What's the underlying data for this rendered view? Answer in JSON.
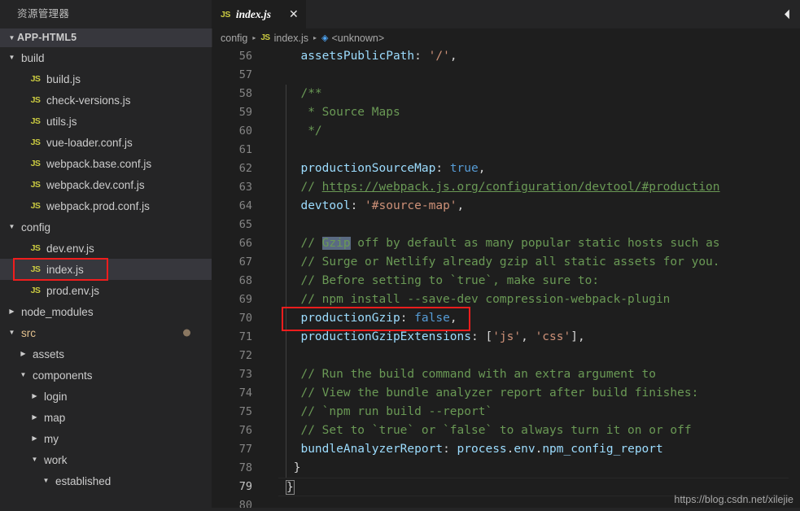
{
  "sidebar": {
    "title": "资源管理器",
    "root_label": "APP-HTML5",
    "items": [
      {
        "label": "build",
        "type": "folder",
        "indent": 1,
        "twist": "open",
        "icon": "folder-icon"
      },
      {
        "label": "build.js",
        "type": "file",
        "indent": 2,
        "twist": "none",
        "icon": "js-file-icon"
      },
      {
        "label": "check-versions.js",
        "type": "file",
        "indent": 2,
        "twist": "none",
        "icon": "js-file-icon"
      },
      {
        "label": "utils.js",
        "type": "file",
        "indent": 2,
        "twist": "none",
        "icon": "js-file-icon"
      },
      {
        "label": "vue-loader.conf.js",
        "type": "file",
        "indent": 2,
        "twist": "none",
        "icon": "js-file-icon"
      },
      {
        "label": "webpack.base.conf.js",
        "type": "file",
        "indent": 2,
        "twist": "none",
        "icon": "js-file-icon"
      },
      {
        "label": "webpack.dev.conf.js",
        "type": "file",
        "indent": 2,
        "twist": "none",
        "icon": "js-file-icon"
      },
      {
        "label": "webpack.prod.conf.js",
        "type": "file",
        "indent": 2,
        "twist": "none",
        "icon": "js-file-icon"
      },
      {
        "label": "config",
        "type": "folder",
        "indent": 1,
        "twist": "open",
        "icon": "folder-icon"
      },
      {
        "label": "dev.env.js",
        "type": "file",
        "indent": 2,
        "twist": "none",
        "icon": "js-file-icon"
      },
      {
        "label": "index.js",
        "type": "file",
        "indent": 2,
        "twist": "none",
        "icon": "js-file-icon",
        "selected": true,
        "highlighted": true
      },
      {
        "label": "prod.env.js",
        "type": "file",
        "indent": 2,
        "twist": "none",
        "icon": "js-file-icon"
      },
      {
        "label": "node_modules",
        "type": "folder",
        "indent": 1,
        "twist": "closed",
        "icon": "folder-icon"
      },
      {
        "label": "src",
        "type": "folder",
        "indent": 1,
        "twist": "open",
        "icon": "folder-icon",
        "accent": true,
        "dirty": true
      },
      {
        "label": "assets",
        "type": "folder",
        "indent": 2,
        "twist": "closed",
        "icon": "folder-icon"
      },
      {
        "label": "components",
        "type": "folder",
        "indent": 2,
        "twist": "open",
        "icon": "folder-icon"
      },
      {
        "label": "login",
        "type": "folder",
        "indent": 3,
        "twist": "closed",
        "icon": "folder-icon"
      },
      {
        "label": "map",
        "type": "folder",
        "indent": 3,
        "twist": "closed",
        "icon": "folder-icon"
      },
      {
        "label": "my",
        "type": "folder",
        "indent": 3,
        "twist": "closed",
        "icon": "folder-icon"
      },
      {
        "label": "work",
        "type": "folder",
        "indent": 3,
        "twist": "open",
        "icon": "folder-icon"
      },
      {
        "label": "established",
        "type": "folder",
        "indent": 4,
        "twist": "open",
        "icon": "folder-icon"
      }
    ]
  },
  "tabs": [
    {
      "label": "index.js",
      "icon": "js-file-icon",
      "close_icon": "close-icon",
      "active": true
    }
  ],
  "tab_actions": {
    "split_icon": "split-editor-icon"
  },
  "breadcrumb": {
    "segments": [
      {
        "label": "config",
        "icon": null
      },
      {
        "label": "index.js",
        "icon": "js-file-icon"
      },
      {
        "label": "<unknown>",
        "icon": "symbol-object-icon"
      }
    ],
    "separator": "▸"
  },
  "editor": {
    "first_line": 56,
    "last_line": 80,
    "active_line": 79,
    "fold_markers": [
      58,
      66,
      73
    ],
    "line_numbers": [
      56,
      57,
      58,
      59,
      60,
      61,
      62,
      63,
      64,
      65,
      66,
      67,
      68,
      69,
      70,
      71,
      72,
      73,
      74,
      75,
      76,
      77,
      78,
      79,
      80
    ],
    "lines": [
      {
        "n": 56,
        "tokens": [
          {
            "t": "  ",
            "c": "punct"
          },
          {
            "t": "assetsPublicPath",
            "c": "prop"
          },
          {
            "t": ": ",
            "c": "punct"
          },
          {
            "t": "'/'",
            "c": "str"
          },
          {
            "t": ",",
            "c": "punct"
          }
        ]
      },
      {
        "n": 57,
        "tokens": []
      },
      {
        "n": 58,
        "tokens": [
          {
            "t": "  /**",
            "c": "cmt"
          }
        ]
      },
      {
        "n": 59,
        "tokens": [
          {
            "t": "   * Source Maps",
            "c": "cmt"
          }
        ]
      },
      {
        "n": 60,
        "tokens": [
          {
            "t": "   */",
            "c": "cmt"
          }
        ]
      },
      {
        "n": 61,
        "tokens": []
      },
      {
        "n": 62,
        "tokens": [
          {
            "t": "  ",
            "c": "punct"
          },
          {
            "t": "productionSourceMap",
            "c": "prop"
          },
          {
            "t": ": ",
            "c": "punct"
          },
          {
            "t": "true",
            "c": "kw"
          },
          {
            "t": ",",
            "c": "punct"
          }
        ]
      },
      {
        "n": 63,
        "tokens": [
          {
            "t": "  // ",
            "c": "cmt"
          },
          {
            "t": "https://webpack.js.org/configuration/devtool/#production",
            "c": "link"
          }
        ]
      },
      {
        "n": 64,
        "tokens": [
          {
            "t": "  ",
            "c": "punct"
          },
          {
            "t": "devtool",
            "c": "prop"
          },
          {
            "t": ": ",
            "c": "punct"
          },
          {
            "t": "'#source-map'",
            "c": "str"
          },
          {
            "t": ",",
            "c": "punct"
          }
        ]
      },
      {
        "n": 65,
        "tokens": []
      },
      {
        "n": 66,
        "tokens": [
          {
            "t": "  // ",
            "c": "cmt"
          },
          {
            "t": "Gzip",
            "c": "sel"
          },
          {
            "t": " off by default as many popular static hosts such as",
            "c": "cmt"
          }
        ]
      },
      {
        "n": 67,
        "tokens": [
          {
            "t": "  // Surge or Netlify already gzip all static assets for you.",
            "c": "cmt"
          }
        ]
      },
      {
        "n": 68,
        "tokens": [
          {
            "t": "  // Before setting to `true`, make sure to:",
            "c": "cmt"
          }
        ]
      },
      {
        "n": 69,
        "tokens": [
          {
            "t": "  // npm install --save-dev compression-webpack-plugin",
            "c": "cmt"
          }
        ]
      },
      {
        "n": 70,
        "tokens": [
          {
            "t": "  ",
            "c": "punct"
          },
          {
            "t": "productionGzip",
            "c": "prop"
          },
          {
            "t": ": ",
            "c": "punct"
          },
          {
            "t": "false",
            "c": "kw"
          },
          {
            "t": ",",
            "c": "punct"
          }
        ],
        "highlighted": true
      },
      {
        "n": 71,
        "tokens": [
          {
            "t": "  ",
            "c": "punct"
          },
          {
            "t": "productionGzipExtensions",
            "c": "prop"
          },
          {
            "t": ": [",
            "c": "punct"
          },
          {
            "t": "'js'",
            "c": "str"
          },
          {
            "t": ", ",
            "c": "punct"
          },
          {
            "t": "'css'",
            "c": "str"
          },
          {
            "t": "],",
            "c": "punct"
          }
        ]
      },
      {
        "n": 72,
        "tokens": []
      },
      {
        "n": 73,
        "tokens": [
          {
            "t": "  // Run the build command with an extra argument to",
            "c": "cmt"
          }
        ]
      },
      {
        "n": 74,
        "tokens": [
          {
            "t": "  // View the bundle analyzer report after build finishes:",
            "c": "cmt"
          }
        ]
      },
      {
        "n": 75,
        "tokens": [
          {
            "t": "  // `npm run build --report`",
            "c": "cmt"
          }
        ]
      },
      {
        "n": 76,
        "tokens": [
          {
            "t": "  // Set to `true` or `false` to always turn it on or off",
            "c": "cmt"
          }
        ]
      },
      {
        "n": 77,
        "tokens": [
          {
            "t": "  ",
            "c": "punct"
          },
          {
            "t": "bundleAnalyzerReport",
            "c": "prop"
          },
          {
            "t": ": ",
            "c": "punct"
          },
          {
            "t": "process",
            "c": "prop"
          },
          {
            "t": ".",
            "c": "punct"
          },
          {
            "t": "env",
            "c": "prop"
          },
          {
            "t": ".",
            "c": "punct"
          },
          {
            "t": "npm_config_report",
            "c": "prop"
          }
        ]
      },
      {
        "n": 78,
        "tokens": [
          {
            "t": " }",
            "c": "punct"
          }
        ]
      },
      {
        "n": 79,
        "tokens": [
          {
            "t": "}",
            "c": "brkt"
          }
        ],
        "active": true
      },
      {
        "n": 80,
        "tokens": []
      }
    ]
  },
  "annotations": {
    "boxes": [
      {
        "name": "sidebar-index-js-highlight",
        "color": "#f01d1d"
      },
      {
        "name": "code-production-gzip-highlight",
        "color": "#f01d1d"
      }
    ]
  },
  "watermark": {
    "text": "https://blog.csdn.net/xilejie"
  },
  "colors": {
    "sidebar_bg": "#252526",
    "editor_bg": "#1e1e1e",
    "selection_bg": "#37373d",
    "accent_red": "#f01d1d",
    "js_icon": "#cbcb41",
    "property": "#9cdcfe",
    "string": "#ce9178",
    "keyword": "#569cd6",
    "comment": "#6a9955",
    "dirty_dot": "#8a7761"
  }
}
